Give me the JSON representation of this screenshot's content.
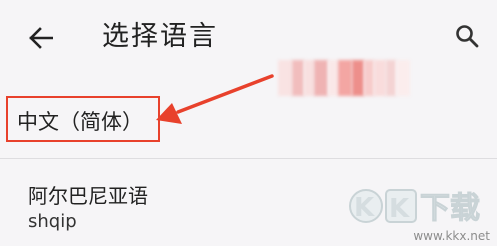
{
  "app_bar": {
    "title": "选择语言",
    "back_icon": "arrow-left-icon",
    "search_icon": "search-icon"
  },
  "languages": [
    {
      "name": "中文（简体）",
      "native": "",
      "highlighted": true
    },
    {
      "name": "阿尔巴尼亚语",
      "native": "shqip",
      "highlighted": false
    }
  ],
  "annotation": {
    "color": "#e8412c"
  },
  "watermark": {
    "logo_text": "KK下载",
    "url": "www.kkx.net"
  }
}
